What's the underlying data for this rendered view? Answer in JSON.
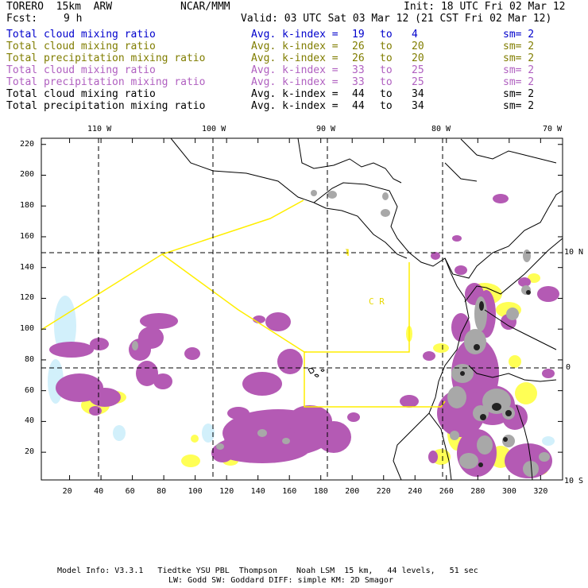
{
  "header": {
    "model_name": "TORERO  15km  ARW",
    "center": "NCAR/MMM",
    "init": "Init: 18 UTC Fri 02 Mar 12",
    "fcst_label": "Fcst:",
    "fcst_value": "9 h",
    "valid": "Valid: 03 UTC Sat 03 Mar 12 (21 CST Fri 02 Mar 12)"
  },
  "legend_rows": [
    {
      "field": "Total cloud mixing ratio",
      "index_label": "Avg. k-index =",
      "from": "19",
      "to_word": "to",
      "to": "4",
      "sm": "sm= 2",
      "color": "#0000cc"
    },
    {
      "field": "Total cloud mixing ratio",
      "index_label": "Avg. k-index =",
      "from": "26",
      "to_word": "to",
      "to": "20",
      "sm": "sm= 2",
      "color": "#807d00"
    },
    {
      "field": "Total precipitation mixing ratio",
      "index_label": "Avg. k-index =",
      "from": "26",
      "to_word": "to",
      "to": "20",
      "sm": "sm= 2",
      "color": "#807d00"
    },
    {
      "field": "Total cloud mixing ratio",
      "index_label": "Avg. k-index =",
      "from": "33",
      "to_word": "to",
      "to": "25",
      "sm": "sm= 2",
      "color": "#b060c0"
    },
    {
      "field": "Total precipitation mixing ratio",
      "index_label": "Avg. k-index =",
      "from": "33",
      "to_word": "to",
      "to": "25",
      "sm": "sm= 2",
      "color": "#b060c0"
    },
    {
      "field": "Total cloud mixing ratio",
      "index_label": "Avg. k-index =",
      "from": "44",
      "to_word": "to",
      "to": "34",
      "sm": "sm= 2",
      "color": "#000000"
    },
    {
      "field": "Total precipitation mixing ratio",
      "index_label": "Avg. k-index =",
      "from": "44",
      "to_word": "to",
      "to": "34",
      "sm": "sm= 2",
      "color": "#000000"
    }
  ],
  "axes": {
    "x_ticks": [
      "20",
      "40",
      "60",
      "80",
      "100",
      "120",
      "140",
      "160",
      "180",
      "200",
      "220",
      "240",
      "260",
      "280",
      "300",
      "320"
    ],
    "y_ticks": [
      "20",
      "40",
      "60",
      "80",
      "100",
      "120",
      "140",
      "160",
      "180",
      "200",
      "220"
    ],
    "lon_labels": [
      "110 W",
      "100 W",
      "90 W",
      "80 W",
      "70 W"
    ],
    "lat_labels": [
      "10 N",
      "0",
      "10 S"
    ]
  },
  "map_text": {
    "region_label": "C R",
    "region_small": "I"
  },
  "footer": {
    "line1": "Model Info: V3.3.1   Tiedtke YSU PBL  Thompson    Noah LSM  15 km,   44 levels,   51 sec",
    "line2": "LW: Godd SW: Goddard DIFF: simple KM: 2D Smagor"
  },
  "colors": {
    "purple_cloud": "#b45ab4",
    "yellow_precip": "#ffff55",
    "cyan_light": "#c8eefa",
    "gray_dense": "#a8a8a8",
    "black_core": "#202020",
    "coast": "#000000",
    "boundary_yellow": "#ffee00"
  }
}
